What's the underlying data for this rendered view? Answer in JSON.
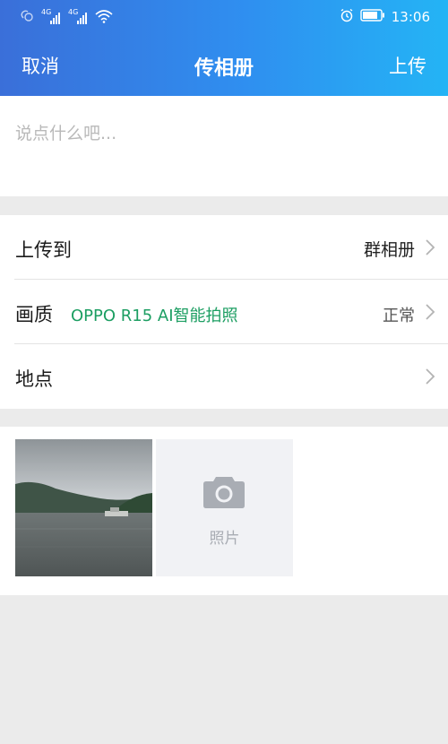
{
  "status_bar": {
    "signal_tag_1": "4G",
    "signal_tag_2": "4G",
    "time": "13:06"
  },
  "nav": {
    "cancel_label": "取消",
    "title": "传相册",
    "upload_label": "上传"
  },
  "composer": {
    "placeholder": "说点什么吧..."
  },
  "settings": {
    "upload_to": {
      "label": "上传到",
      "value": "群相册"
    },
    "quality": {
      "label": "画质",
      "watermark": "OPPO R15  AI智能拍照",
      "value": "正常"
    },
    "location": {
      "label": "地点"
    }
  },
  "photos": {
    "add_label": "照片"
  },
  "colors": {
    "header_start": "#3a6fd9",
    "header_end": "#24b4f5",
    "watermark_green": "#1c9e62",
    "background": "#ebebeb"
  },
  "icons": [
    "hd-voice-icon",
    "signal-icon",
    "wifi-icon",
    "alarm-icon",
    "battery-icon",
    "chevron-right-icon",
    "camera-icon"
  ]
}
